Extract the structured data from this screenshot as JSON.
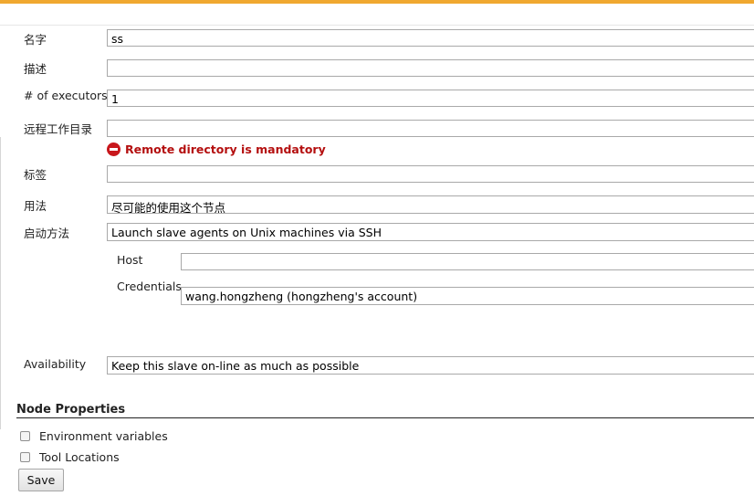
{
  "form": {
    "name_label": "名字",
    "name_value": "ss",
    "description_label": "描述",
    "description_value": "",
    "executors_label": "# of executors",
    "executors_value": "1",
    "remote_dir_label": "远程工作目录",
    "remote_dir_value": "",
    "remote_dir_error": "Remote directory is mandatory",
    "labels_label": "标签",
    "labels_value": "",
    "usage_label": "用法",
    "usage_value": "尽可能的使用这个节点",
    "launch_label": "启动方法",
    "launch_value": "Launch slave agents on Unix machines via SSH",
    "host_label": "Host",
    "host_value": "",
    "credentials_label": "Credentials",
    "credentials_value": "wang.hongzheng (hongzheng's account)",
    "availability_label": "Availability",
    "availability_value": "Keep this slave on-line as much as possible"
  },
  "node_properties": {
    "title": "Node Properties",
    "options": [
      "Environment variables",
      "Tool Locations"
    ]
  },
  "actions": {
    "save_label": "Save"
  },
  "colors": {
    "accent": "#f0a830",
    "error": "#b40f0f"
  }
}
